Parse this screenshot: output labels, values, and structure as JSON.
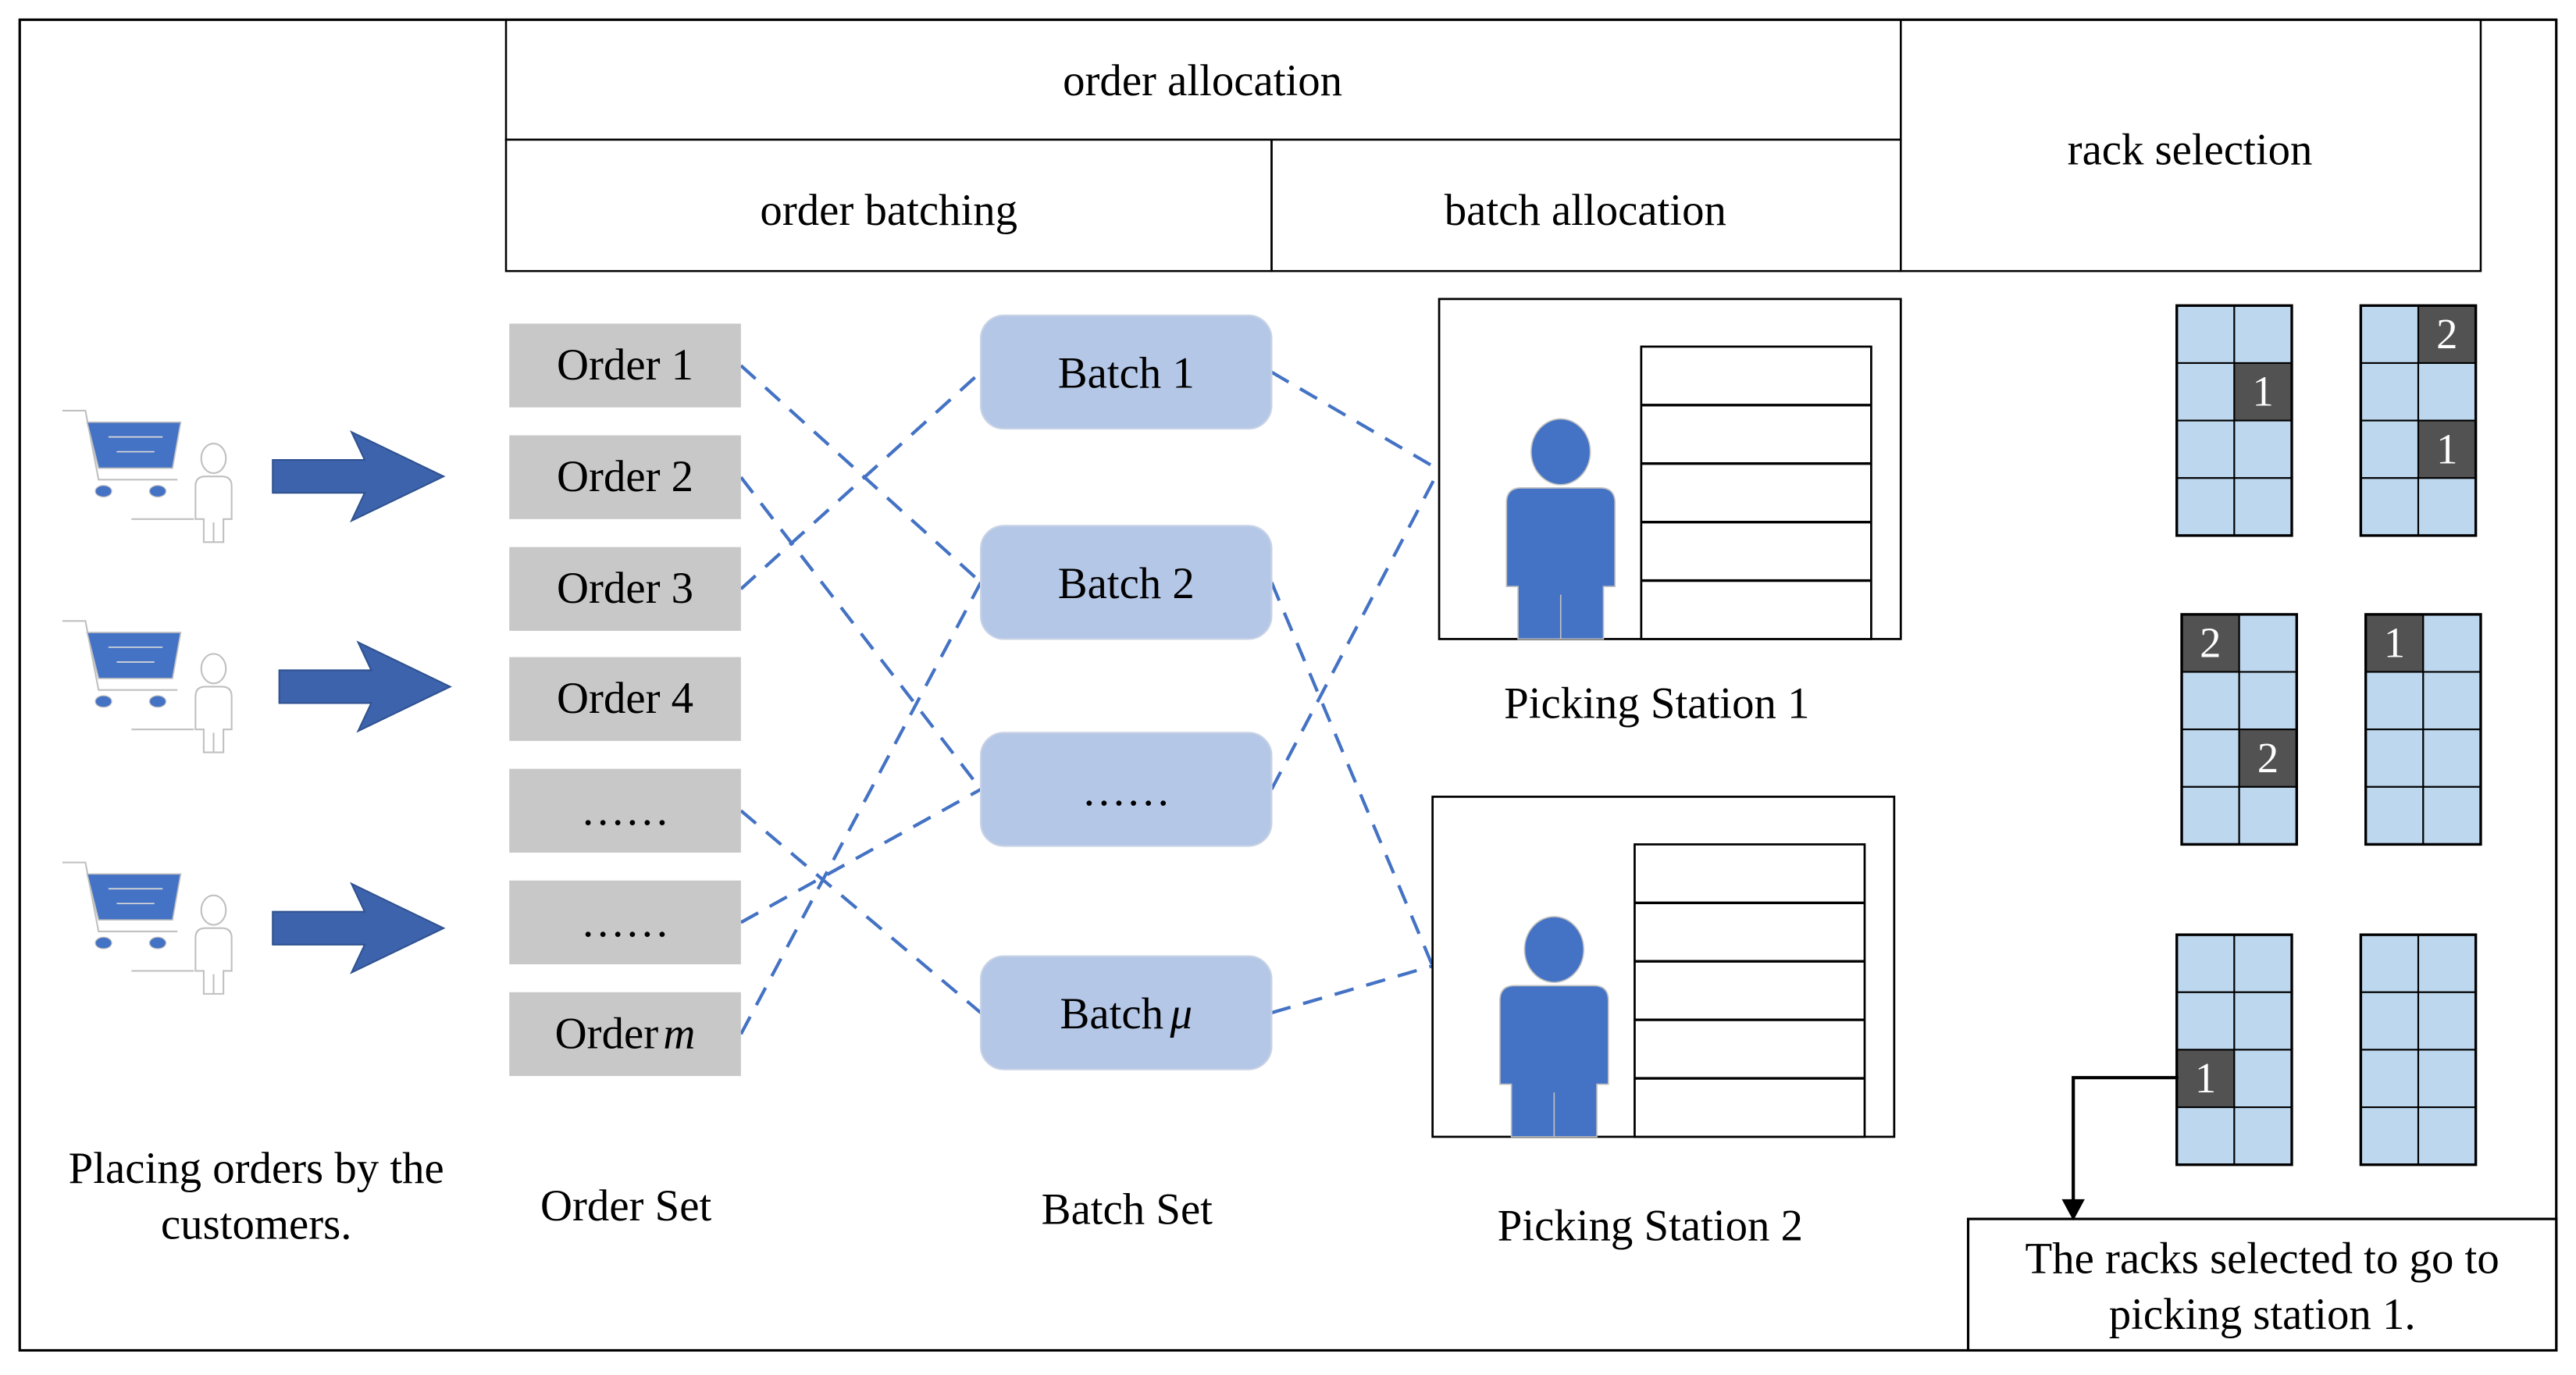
{
  "header": {
    "order_allocation": "order allocation",
    "order_batching": "order batching",
    "batch_allocation": "batch allocation",
    "rack_selection": "rack selection"
  },
  "colors": {
    "arrow_blue": "#3d63ad",
    "person_blue": "#4472c4",
    "dashed_line": "#4472c4",
    "order_box": "#c8c8c8",
    "batch_box": "#b4c7e7",
    "rack_cell": "#bdd7ee",
    "rack_selected": "#525252",
    "outline_gray": "#c0c0c0"
  },
  "customers": {
    "count": 3,
    "caption_line1": "Placing orders by the",
    "caption_line2": "customers."
  },
  "orders": {
    "items": [
      "Order 1",
      "Order 2",
      "Order 3",
      "Order 4",
      "……",
      "……",
      "Order m"
    ],
    "caption": "Order Set"
  },
  "batches": {
    "items": [
      "Batch 1",
      "Batch 2",
      "……",
      "Batch μ"
    ],
    "caption": "Batch Set"
  },
  "stations": {
    "items": [
      {
        "label": "Picking Station 1",
        "shelf_rows": 5
      },
      {
        "label": "Picking Station 2",
        "shelf_rows": 5
      }
    ]
  },
  "order_to_batch": [
    {
      "order": 0,
      "batch": 1
    },
    {
      "order": 1,
      "batch": 2
    },
    {
      "order": 2,
      "batch": 0
    },
    {
      "order": 4,
      "batch": 3
    },
    {
      "order": 5,
      "batch": 2
    },
    {
      "order": 6,
      "batch": 1
    }
  ],
  "batch_to_station": [
    {
      "batch": 0,
      "station": 0
    },
    {
      "batch": 1,
      "station": 1
    },
    {
      "batch": 2,
      "station": 0
    },
    {
      "batch": 3,
      "station": 1
    }
  ],
  "racks": [
    {
      "rows": 4,
      "cols": 2,
      "marked": [
        {
          "row": 1,
          "col": 1,
          "value": "1"
        }
      ]
    },
    {
      "rows": 4,
      "cols": 2,
      "marked": [
        {
          "row": 0,
          "col": 1,
          "value": "2"
        },
        {
          "row": 2,
          "col": 1,
          "value": "1"
        }
      ]
    },
    {
      "rows": 4,
      "cols": 2,
      "marked": [
        {
          "row": 0,
          "col": 0,
          "value": "2"
        },
        {
          "row": 2,
          "col": 1,
          "value": "2"
        }
      ]
    },
    {
      "rows": 4,
      "cols": 2,
      "marked": [
        {
          "row": 0,
          "col": 0,
          "value": "1"
        }
      ]
    },
    {
      "rows": 4,
      "cols": 2,
      "marked": [
        {
          "row": 2,
          "col": 0,
          "value": "1"
        }
      ]
    },
    {
      "rows": 4,
      "cols": 2,
      "marked": []
    }
  ],
  "callout": {
    "line1": "The racks selected to go to",
    "line2": "picking station 1."
  }
}
